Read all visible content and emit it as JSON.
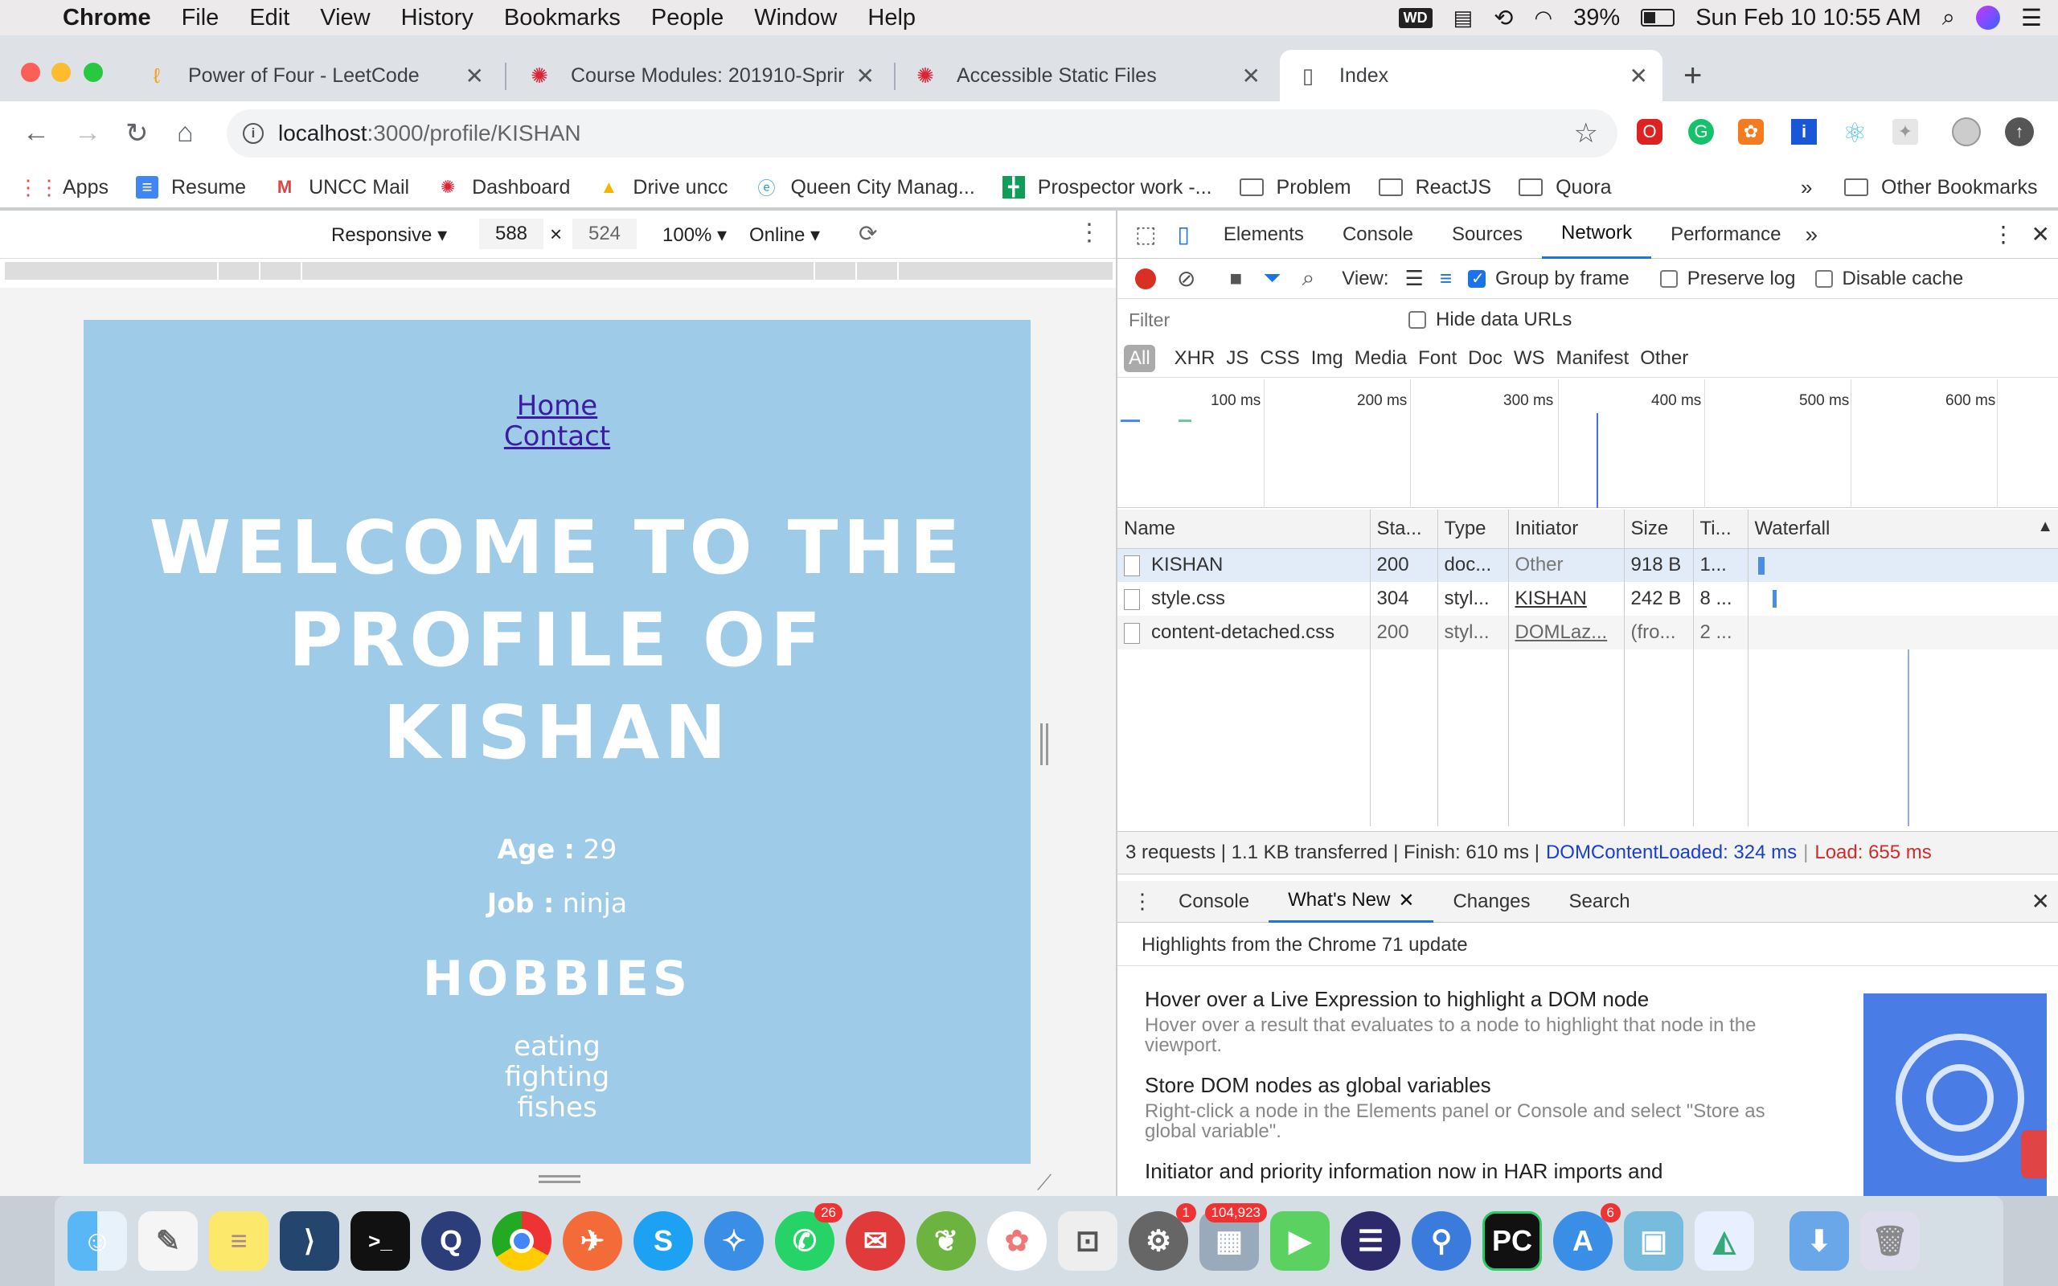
{
  "menubar": {
    "app": "Chrome",
    "items": [
      "File",
      "Edit",
      "View",
      "History",
      "Bookmarks",
      "People",
      "Window",
      "Help"
    ],
    "battery": "39%",
    "datetime": "Sun Feb 10  10:55 AM"
  },
  "tabs": [
    {
      "title": "Power of Four - LeetCode",
      "icon": "leetcode-icon"
    },
    {
      "title": "Course Modules: 201910-Sprin",
      "icon": "canvas-icon"
    },
    {
      "title": "Accessible Static Files",
      "icon": "canvas-icon"
    },
    {
      "title": "Index",
      "icon": "page-icon"
    }
  ],
  "url": {
    "host": "localhost",
    "path": ":3000/profile/KISHAN"
  },
  "bookmarks": [
    "Apps",
    "Resume",
    "UNCC Mail",
    "Dashboard",
    "Drive uncc",
    "Queen City Manag...",
    "Prospector work -...",
    "Problem",
    "ReactJS",
    "Quora"
  ],
  "other_bookmarks": "Other Bookmarks",
  "device": {
    "mode": "Responsive",
    "width": "588",
    "height": "524",
    "zoom": "100%",
    "network": "Online"
  },
  "page": {
    "links": [
      "Home",
      "Contact"
    ],
    "heading": "WELCOME TO THE PROFILE OF KISHAN",
    "age_label": "Age :",
    "age": "29",
    "job_label": "Job :",
    "job": "ninja",
    "hobbies_title": "HOBBIES",
    "hobbies": [
      "eating",
      "fighting",
      "fishes"
    ]
  },
  "devtools": {
    "tabs": [
      "Elements",
      "Console",
      "Sources",
      "Network",
      "Performance"
    ],
    "active_tab": "Network",
    "view_label": "View:",
    "group_by_frame": "Group by frame",
    "preserve_log": "Preserve log",
    "disable_cache": "Disable cache",
    "filter_placeholder": "Filter",
    "hide_data_urls": "Hide data URLs",
    "types": [
      "All",
      "XHR",
      "JS",
      "CSS",
      "Img",
      "Media",
      "Font",
      "Doc",
      "WS",
      "Manifest",
      "Other"
    ],
    "timeline_ticks": [
      "100 ms",
      "200 ms",
      "300 ms",
      "400 ms",
      "500 ms",
      "600 ms"
    ],
    "columns": [
      "Name",
      "Sta...",
      "Type",
      "Initiator",
      "Size",
      "Ti...",
      "Waterfall"
    ],
    "rows": [
      {
        "name": "KISHAN",
        "status": "200",
        "type": "doc...",
        "initiator": "Other",
        "size": "918 B",
        "time": "1..."
      },
      {
        "name": "style.css",
        "status": "304",
        "type": "styl...",
        "initiator": "KISHAN",
        "size": "242 B",
        "time": "8 ..."
      },
      {
        "name": "content-detached.css",
        "status": "200",
        "type": "styl...",
        "initiator": "DOMLaz...",
        "size": "(fro...",
        "time": "2 ..."
      }
    ],
    "summary": "3 requests | 1.1 KB transferred | Finish: 610 ms |",
    "domcontentloaded": "DOMContentLoaded: 324 ms",
    "load": "Load: 655 ms",
    "drawer_tabs": [
      "Console",
      "What's New",
      "Changes",
      "Search"
    ],
    "drawer_active": "What's New",
    "highlights_title": "Highlights from the Chrome 71 update",
    "news": [
      {
        "title": "Hover over a Live Expression to highlight a DOM node",
        "body": "Hover over a result that evaluates to a node to highlight that node in the viewport."
      },
      {
        "title": "Store DOM nodes as global variables",
        "body": "Right-click a node in the Elements panel or Console and select \"Store as global variable\"."
      },
      {
        "title": "Initiator and priority information now in HAR imports and",
        "body": ""
      }
    ]
  },
  "dock_badges": {
    "whatsapp": "26",
    "sysprefs": "1",
    "preview": "104,923",
    "appstore": "6"
  }
}
